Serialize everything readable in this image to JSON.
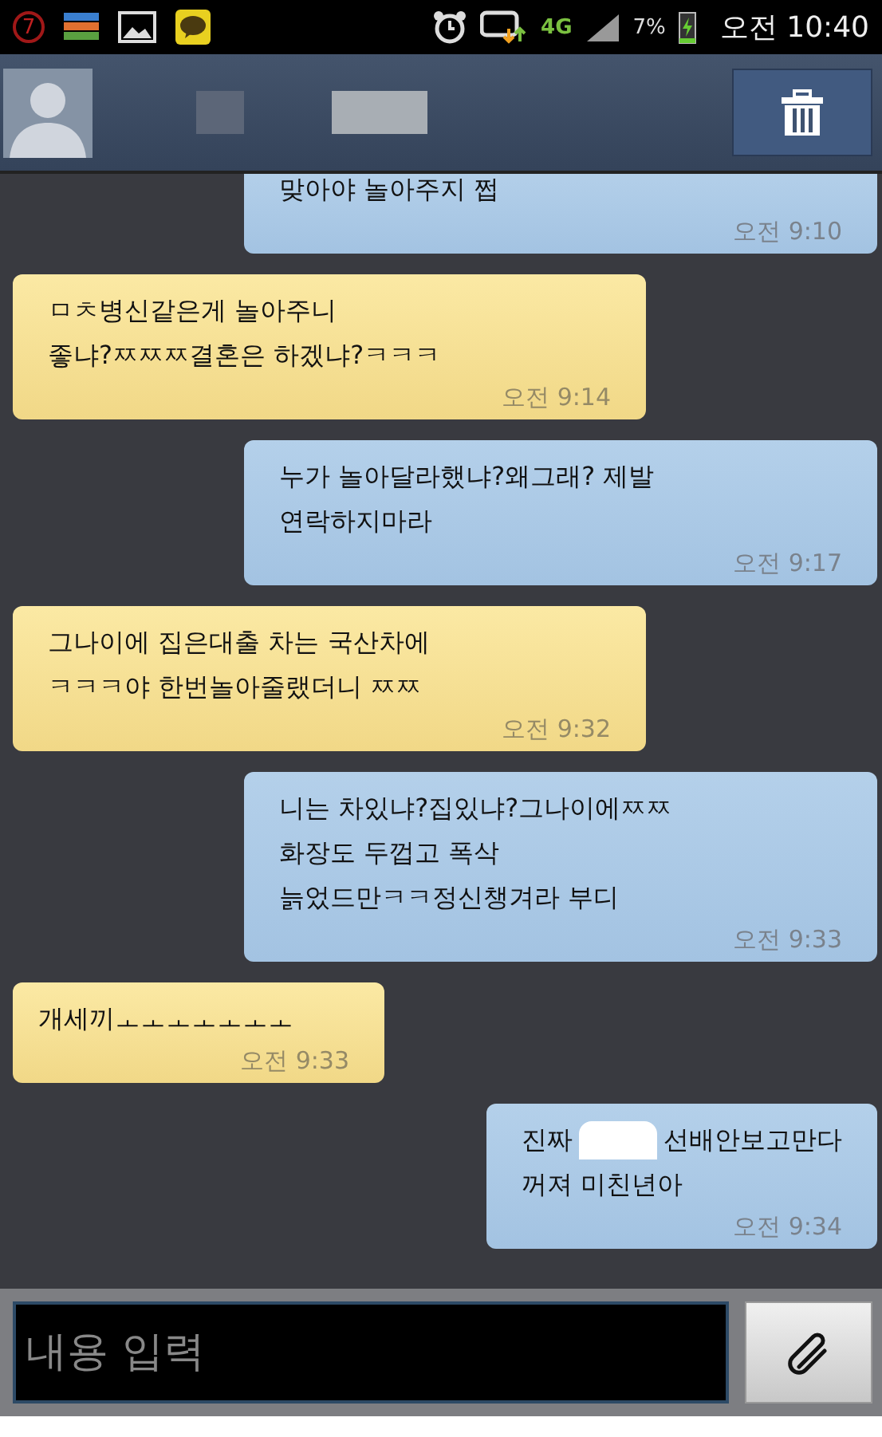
{
  "status_bar": {
    "notification_count": "7",
    "network": "4G",
    "battery": "7%",
    "time": "오전 10:40"
  },
  "messages": [
    {
      "kind": "sent",
      "lines": [
        [
          "맞아야 놀아주지 쩝"
        ]
      ],
      "time": "오전 9:10",
      "cut_top": true
    },
    {
      "kind": "received",
      "lines": [
        [
          "ㅁㅊ병신같은게 놀아주니"
        ],
        [
          "좋냐?ㅉㅉㅉ결혼은 하겠냐?ㅋㅋㅋ"
        ]
      ],
      "time": "오전 9:14",
      "cut_top": false
    },
    {
      "kind": "sent",
      "lines": [
        [
          "누가 놀아달라했냐?왜그래? 제발"
        ],
        [
          "연락하지마라"
        ]
      ],
      "time": "오전 9:17",
      "cut_top": false
    },
    {
      "kind": "received",
      "lines": [
        [
          "그나이에 집은대출 차는 국산차에"
        ],
        [
          "ㅋㅋㅋ야 한번놀아줄랬더니 ㅉㅉ"
        ]
      ],
      "time": "오전 9:32",
      "cut_top": false
    },
    {
      "kind": "sent",
      "lines": [
        [
          "니는 차있냐?집있냐?그나이에ㅉㅉ"
        ],
        [
          "화장도 두껍고 폭삭"
        ],
        [
          "늙었드만ㅋㅋ정신챙겨라 부디"
        ]
      ],
      "time": "오전 9:33",
      "cut_top": false
    },
    {
      "kind": "received",
      "lines": [
        [
          "개세끼ㅗㅗㅗㅗㅗㅗㅗ"
        ]
      ],
      "time": "오전 9:33",
      "cut_top": false
    },
    {
      "kind": "sent",
      "lines": [
        [
          "진짜",
          "선배안보고만다"
        ],
        [
          "꺼져 미친년아"
        ]
      ],
      "time": "오전 9:34",
      "cut_top": false
    }
  ],
  "composer": {
    "placeholder": "내용 입력"
  }
}
